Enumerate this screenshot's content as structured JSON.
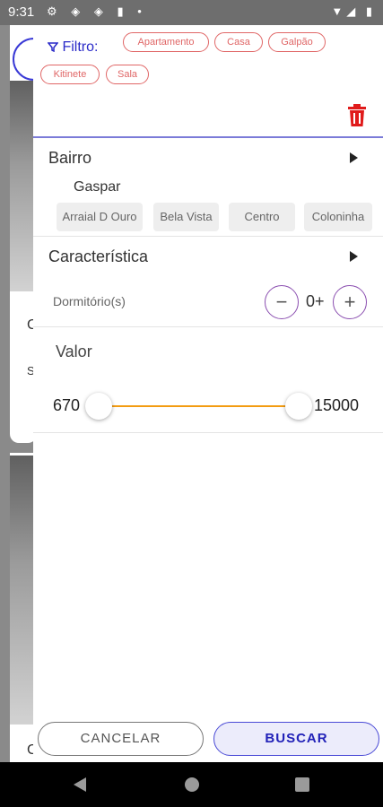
{
  "status_bar": {
    "time": "9:31",
    "left_icons": "⚙ ◈ ◈ ▮ •",
    "right_icons": "▼◢ ▮"
  },
  "background_page": {
    "text_1": "C",
    "text_2": "S",
    "text_3": "C"
  },
  "filter": {
    "label": "Filtro:",
    "chips": [
      "Apartamento",
      "Casa",
      "Galpão",
      "Kitinete",
      "Sala"
    ]
  },
  "bairro": {
    "title": "Bairro",
    "city": "Gaspar",
    "neighborhoods": [
      "Arraial D Ouro",
      "Bela Vista",
      "Centro",
      "Coloninha"
    ]
  },
  "caracteristica": {
    "title": "Característica",
    "dormitorios_label": "Dormitório(s)",
    "dormitorios_value": "0+",
    "minus": "−",
    "plus": "+"
  },
  "valor": {
    "title": "Valor",
    "min": "670",
    "max": "15000"
  },
  "actions": {
    "cancel": "CANCELAR",
    "search": "BUSCAR"
  }
}
